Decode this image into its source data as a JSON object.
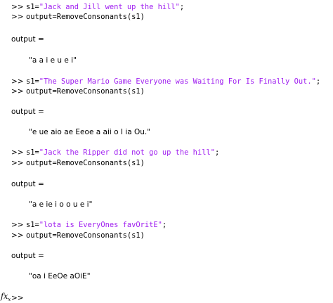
{
  "console": {
    "prompt": ">>",
    "blocks": [
      {
        "assign_prefix": "s1=",
        "string_literal": "\"Jack and Jill went up the hill\"",
        "assign_suffix": ";",
        "call": "output=RemoveConsonants(s1)",
        "output_label": "output =",
        "output_value": "\"a a i e u e i\""
      },
      {
        "assign_prefix": "s1=",
        "string_literal": "\"The Super Mario Game Everyone was Waiting For Is Finally Out.\"",
        "assign_suffix": ";",
        "call": "output=RemoveConsonants(s1)",
        "output_label": "output =",
        "output_value": "\"e ue aio ae Eeoe a aii o I ia Ou.\""
      },
      {
        "assign_prefix": "s1=",
        "string_literal": "\"Jack the Ripper did not go up the hill\"",
        "assign_suffix": ";",
        "call": "output=RemoveConsonants(s1)",
        "output_label": "output =",
        "output_value": "\"a e ie i o o u e i\""
      },
      {
        "assign_prefix": "s1=",
        "string_literal": "\"lota is EveryOnes favOritE\"",
        "assign_suffix": ";",
        "call": "output=RemoveConsonants(s1)",
        "output_label": "output =",
        "output_value": "\"oa i EeOe aOiE\""
      }
    ],
    "fx_glyph": "fx",
    "fx_sub": "x"
  },
  "colors": {
    "string": "#a020f0",
    "text": "#000000",
    "background": "#ffffff"
  }
}
